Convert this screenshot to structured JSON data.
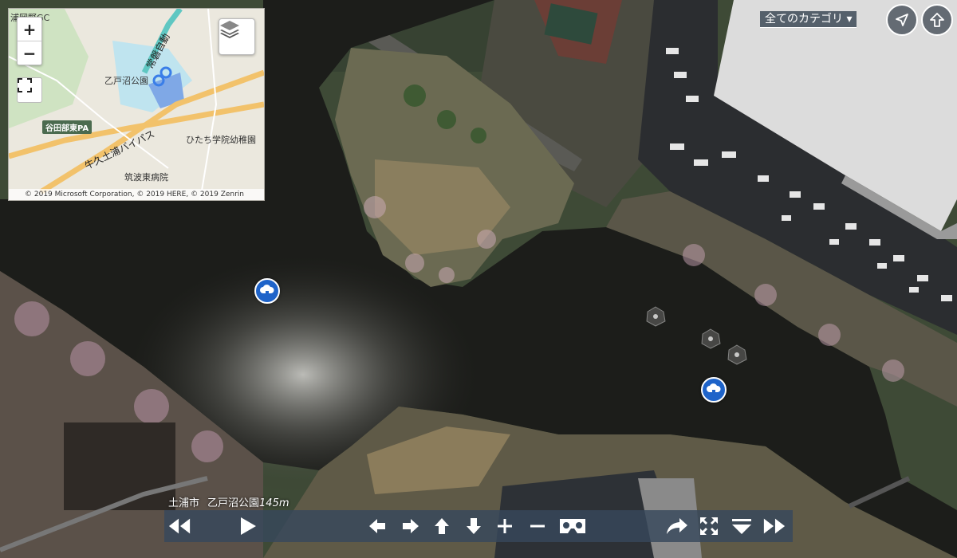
{
  "minimap": {
    "labels": {
      "top_left": "浦岡野GC",
      "park": "乙戸沼公園",
      "pa": "谷田部東PA",
      "bypass": "牛久土浦バイパス",
      "expressway": "常磐自動",
      "kindergarten": "ひたち学院幼稚園",
      "hospital": "筑波東病院"
    },
    "copyright": "© 2019 Microsoft Corporation, © 2019 HERE, © 2019 Zenrin",
    "zoom_in": "+",
    "zoom_out": "−"
  },
  "category": {
    "label": "全てのカテゴリ ▾"
  },
  "location": {
    "city": "土浦市",
    "place": "乙戸沼公園",
    "altitude": "145m"
  },
  "icons": {
    "zoom_in": "plus-icon",
    "zoom_out": "minus-icon",
    "fullscreen": "fullscreen-icon",
    "layers": "layers-icon",
    "navigate": "navigation-arrow-icon",
    "up": "up-arrow-icon",
    "hotspot": "cloud-download-icon"
  },
  "colors": {
    "toolbar": "#37485c",
    "hotspot": "#1e63c9",
    "water": "#1c1d1a"
  }
}
